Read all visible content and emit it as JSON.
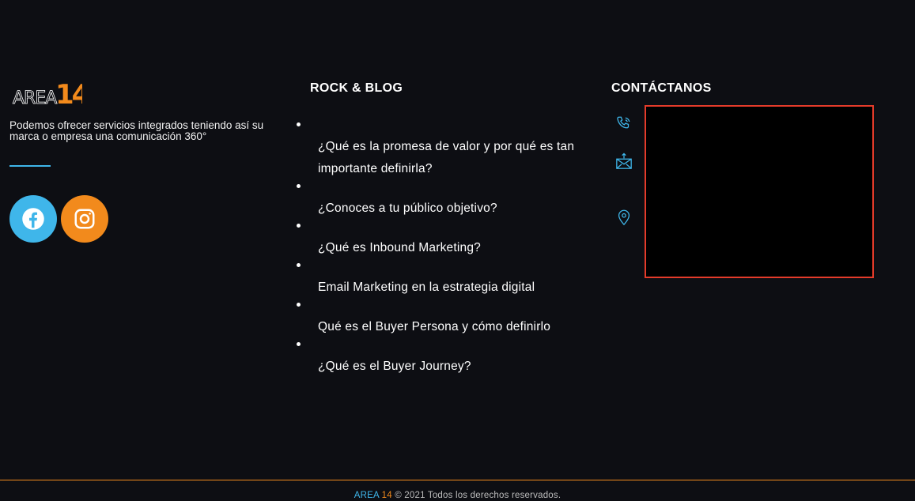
{
  "brand": {
    "logo_text": "AREA",
    "logo_number": "14",
    "tagline": "Podemos ofrecer servicios integrados teniendo así su marca o empresa una comunicación 360°"
  },
  "social": [
    {
      "name": "facebook",
      "icon": "facebook-icon",
      "color": "#3fb6ea"
    },
    {
      "name": "instagram",
      "icon": "instagram-icon",
      "color": "#f28a1c"
    }
  ],
  "blog": {
    "title": "ROCK & BLOG",
    "items": [
      {
        "label": "¿Qué es la promesa de valor y por qué es tan importante definirla?"
      },
      {
        "label": "¿Conoces a tu público objetivo?"
      },
      {
        "label": "¿Qué es Inbound Marketing?"
      },
      {
        "label": "Email Marketing en la estrategia digital"
      },
      {
        "label": "Qué es el Buyer Persona y cómo definirlo"
      },
      {
        "label": "¿Qué es el Buyer Journey?"
      }
    ]
  },
  "contact": {
    "title": "CONTÁCTANOS",
    "icons": [
      "phone-icon",
      "mail-icon",
      "location-pin-icon"
    ]
  },
  "footer": {
    "brand_a": "AREA",
    "brand_14": "14",
    "copyright": "© 2021 Todos los derechos reservados."
  },
  "colors": {
    "background": "#0d0e13",
    "accent_blue": "#3fb6ea",
    "accent_orange": "#f28a1c",
    "map_border": "#e43b2a"
  }
}
